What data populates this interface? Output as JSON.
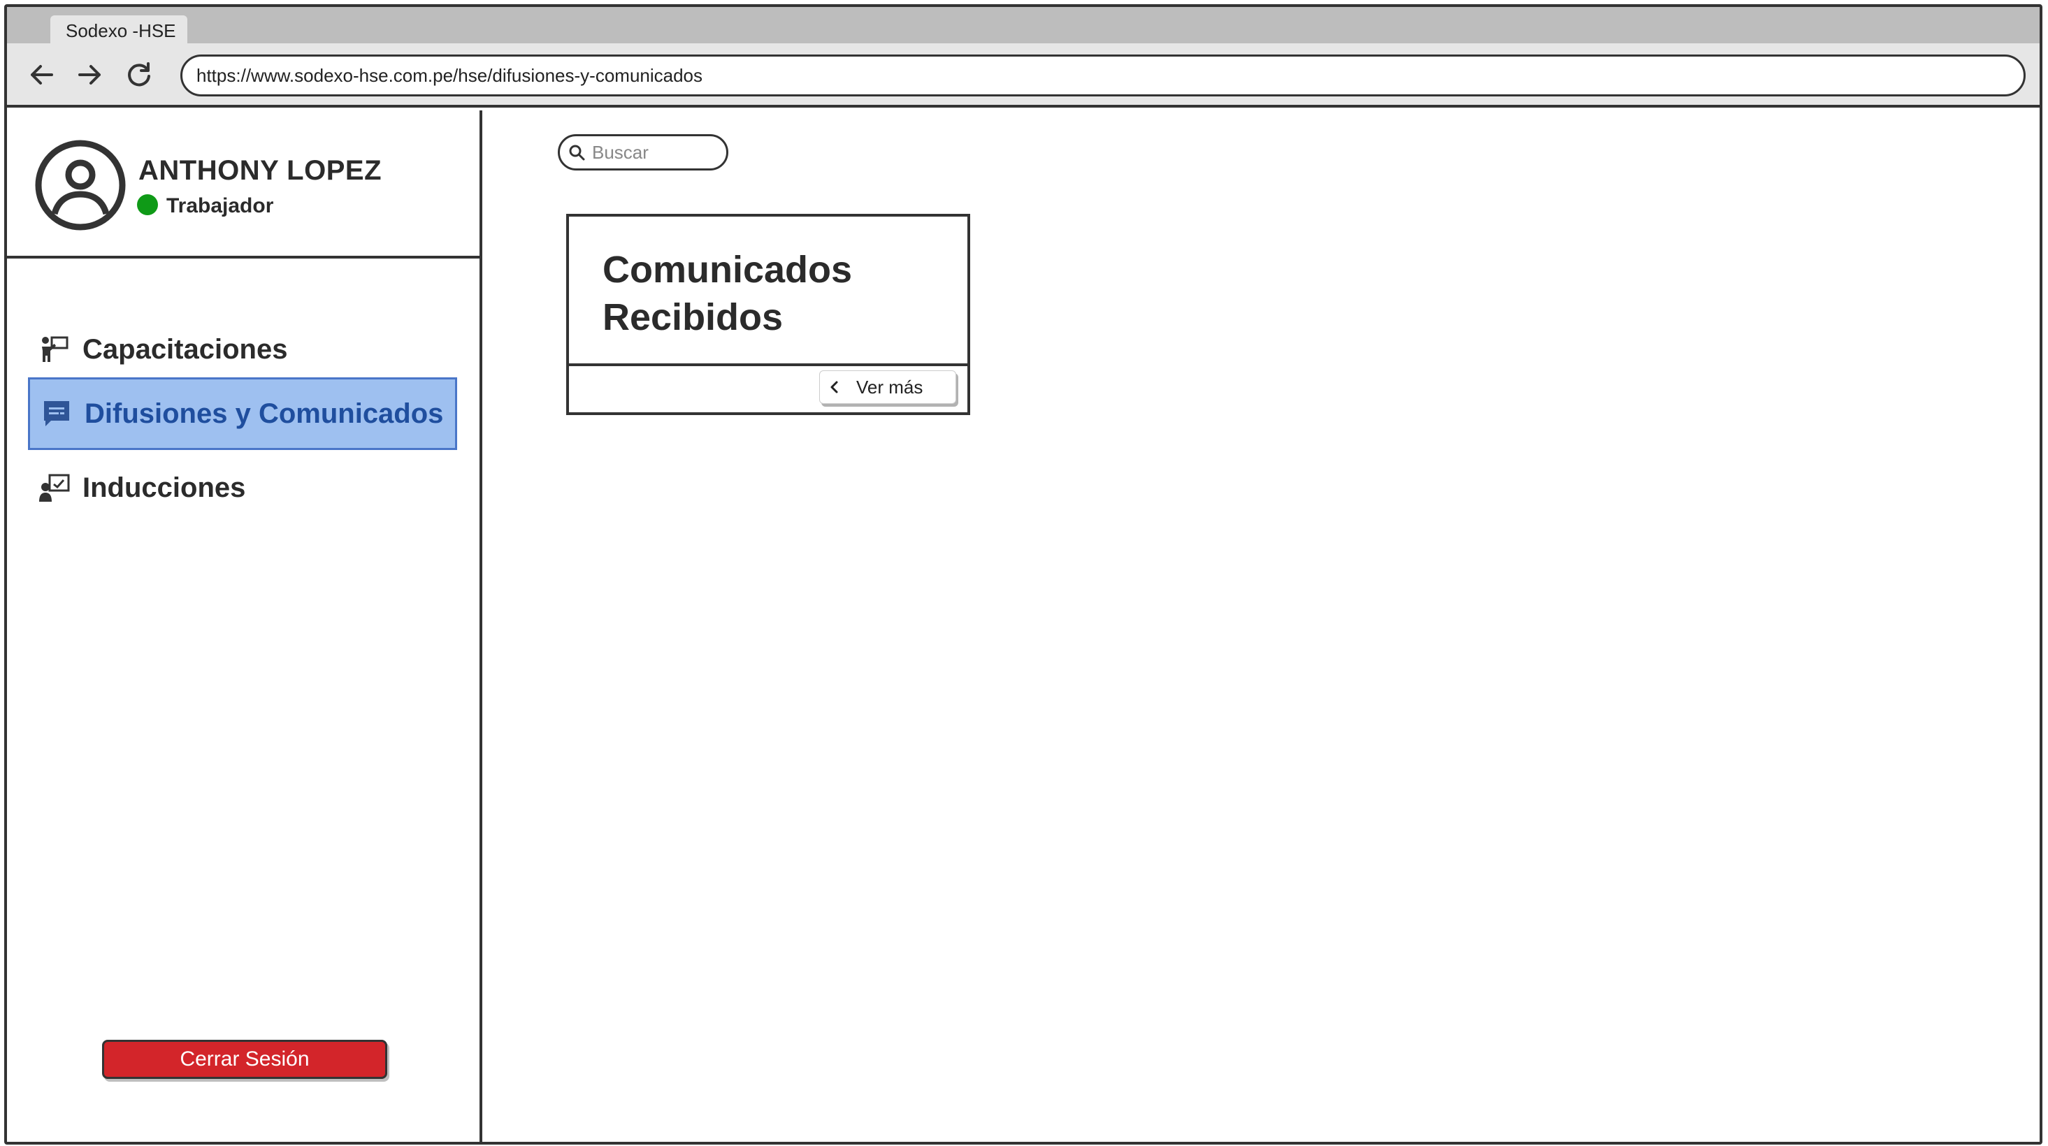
{
  "browser": {
    "tab_title": "Sodexo -HSE",
    "url": "https://www.sodexo-hse.com.pe/hse/difusiones-y-comunicados",
    "icons": [
      "back-arrow-icon",
      "forward-arrow-icon",
      "reload-icon"
    ]
  },
  "profile": {
    "name": "ANTHONY LOPEZ",
    "role": "Trabajador",
    "status_color": "#0f9a17",
    "avatar_icon": "user-circle-icon"
  },
  "sidebar": {
    "items": [
      {
        "label": "Capacitaciones",
        "icon": "presenter-icon",
        "active": false
      },
      {
        "label": "Difusiones y Comunicados",
        "icon": "chat-message-icon",
        "active": true
      },
      {
        "label": "Inducciones",
        "icon": "user-board-icon",
        "active": false
      }
    ],
    "logout_label": "Cerrar Sesión",
    "active_color": "#9ec0f0",
    "logout_color": "#d3252a"
  },
  "search": {
    "placeholder": "Buscar",
    "icon": "search-icon"
  },
  "card": {
    "title": "Comunicados Recibidos",
    "button_label": "Ver más",
    "button_icon": "chevron-left-icon"
  }
}
